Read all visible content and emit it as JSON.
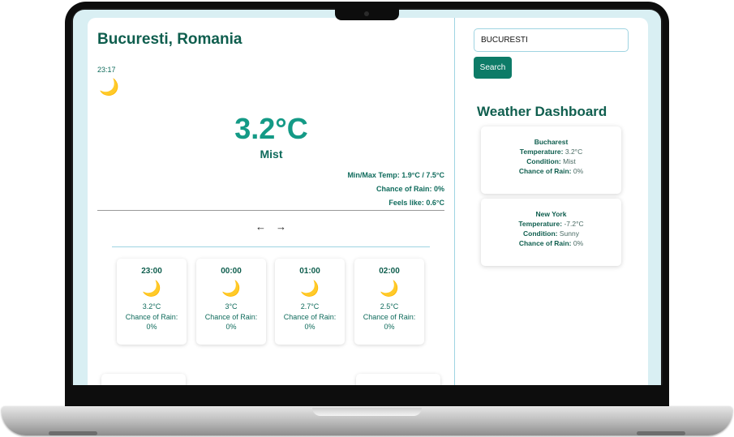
{
  "left": {
    "city": "Bucuresti, Romania",
    "time": "23:17",
    "icon": "moon-icon",
    "temperature": "3.2°C",
    "condition": "Mist",
    "minmax": "Min/Max Temp: 1.9°C / 7.5°C",
    "rain": "Chance of Rain: 0%",
    "feels": "Feels like: 0.6°C",
    "prev_arrow": "←",
    "next_arrow": "→"
  },
  "hourly": [
    {
      "time": "23:00",
      "temp": "3.2°C",
      "rain_label": "Chance of Rain:",
      "rain_value": "0%"
    },
    {
      "time": "00:00",
      "temp": "3°C",
      "rain_label": "Chance of Rain:",
      "rain_value": "0%"
    },
    {
      "time": "01:00",
      "temp": "2.7°C",
      "rain_label": "Chance of Rain:",
      "rain_value": "0%"
    },
    {
      "time": "02:00",
      "temp": "2.5°C",
      "rain_label": "Chance of Rain:",
      "rain_value": "0%"
    }
  ],
  "search": {
    "value": "BUCURESTI",
    "button": "Search"
  },
  "dashboard": {
    "title": "Weather Dashboard",
    "cities": [
      {
        "name": "Bucharest",
        "temp_label": "Temperature:",
        "temp": "3.2°C",
        "cond_label": "Condition:",
        "cond": "Mist",
        "rain_label": "Chance of Rain:",
        "rain": "0%"
      },
      {
        "name": "New York",
        "temp_label": "Temperature:",
        "temp": "-7.2°C",
        "cond_label": "Condition:",
        "cond": "Sunny",
        "rain_label": "Chance of Rain:",
        "rain": "0%"
      }
    ]
  },
  "colors": {
    "accent": "#149a86",
    "dark_green": "#0f5e4e",
    "button": "#0d7b67",
    "screen_bg": "#d9eff3",
    "moon": "#f2c12e"
  }
}
